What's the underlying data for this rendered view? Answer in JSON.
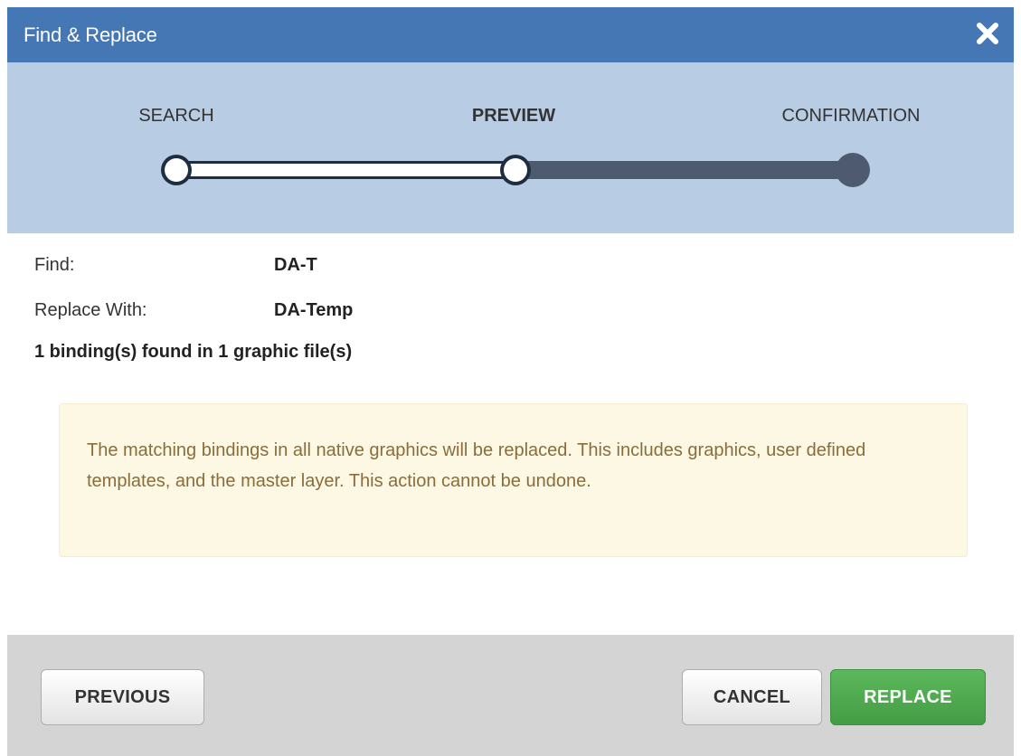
{
  "dialog": {
    "title": "Find & Replace",
    "close_icon": "close-icon"
  },
  "wizard": {
    "steps": [
      {
        "label": "SEARCH",
        "state": "completed"
      },
      {
        "label": "PREVIEW",
        "state": "current"
      },
      {
        "label": "CONFIRMATION",
        "state": "pending"
      }
    ],
    "colors": {
      "completed_track": "#ffffff",
      "pending_track": "#4d5a6f",
      "node_outline": "#1f2d40"
    }
  },
  "form": {
    "find_label": "Find:",
    "find_value": "DA-T",
    "replace_label": "Replace With:",
    "replace_value": "DA-Temp",
    "summary": "1 binding(s) found in 1 graphic file(s)"
  },
  "warning": {
    "text": "The matching bindings in all native graphics will be replaced. This includes graphics, user defined templates, and the master layer. This action cannot be undone."
  },
  "footer": {
    "previous_label": "PREVIOUS",
    "cancel_label": "CANCEL",
    "replace_label": "REPLACE"
  },
  "colors": {
    "title_bar": "#4577b5",
    "wizard_bg": "#b8cde4",
    "warning_bg": "#fcf8e3",
    "warning_text": "#8a6d3b",
    "primary_button": "#5cb85c",
    "footer_bg": "#d4d4d4"
  }
}
